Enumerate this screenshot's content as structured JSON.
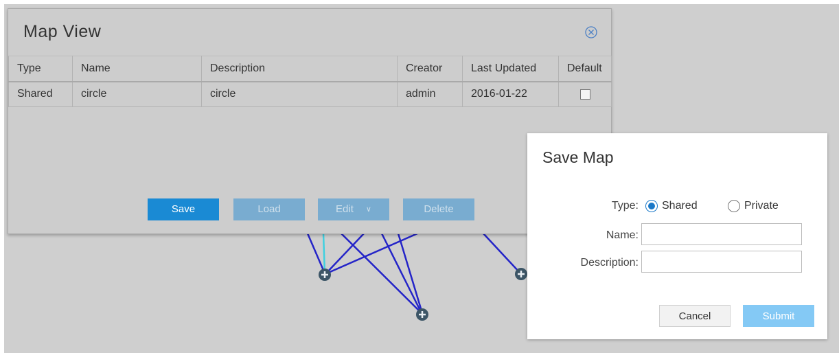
{
  "colors": {
    "backdrop": "#cfcfcf",
    "primary": "#1a8ad4",
    "disabled": "#79acd0",
    "link_line": "#2424c8",
    "highlight_line": "#3fd0e0",
    "submit": "#84c9f5"
  },
  "map_view": {
    "title": "Map View",
    "close_icon": "close-circle-icon",
    "table": {
      "headers": [
        "Type",
        "Name",
        "Description",
        "Creator",
        "Last Updated",
        "Default"
      ],
      "rows": [
        {
          "type": "Shared",
          "name": "circle",
          "description": "circle",
          "creator": "admin",
          "last_updated": "2016-01-22",
          "default": false
        }
      ]
    },
    "buttons": {
      "save": "Save",
      "load": "Load",
      "edit": "Edit",
      "delete": "Delete"
    }
  },
  "save_map": {
    "title": "Save Map",
    "type_label": "Type:",
    "type_options": [
      {
        "label": "Shared",
        "selected": true
      },
      {
        "label": "Private",
        "selected": false
      }
    ],
    "name_label": "Name:",
    "name_value": "",
    "description_label": "Description:",
    "description_value": "",
    "cancel": "Cancel",
    "submit": "Submit"
  }
}
